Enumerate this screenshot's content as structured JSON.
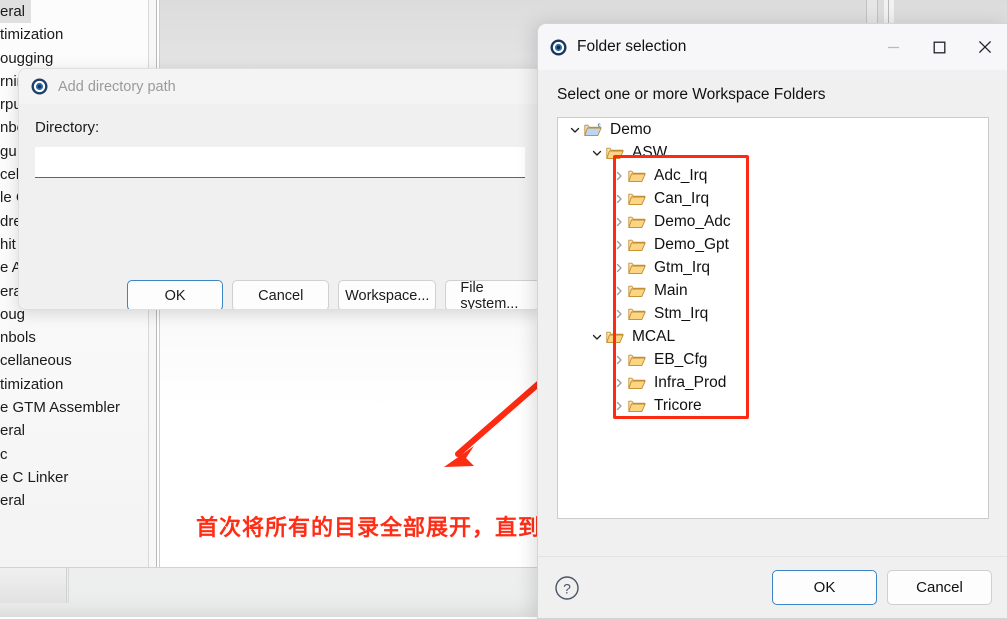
{
  "background": {
    "tree_items": [
      {
        "label": "eral",
        "selected": true
      },
      {
        "label": "timization",
        "selected": false
      },
      {
        "label": "ougging",
        "selected": false
      },
      {
        "label": "rnin",
        "selected": false
      },
      {
        "label": "rpu",
        "selected": false
      },
      {
        "label": "nbo",
        "selected": false
      },
      {
        "label": "gu",
        "selected": false
      },
      {
        "label": "cel",
        "selected": false
      },
      {
        "label": "le C",
        "selected": false
      },
      {
        "label": "dre",
        "selected": false
      },
      {
        "label": "hit",
        "selected": false
      },
      {
        "label": "e A",
        "selected": false
      },
      {
        "label": "eral",
        "selected": false
      },
      {
        "label": "oug",
        "selected": false
      },
      {
        "label": "nbols",
        "selected": false
      },
      {
        "label": "cellaneous",
        "selected": false
      },
      {
        "label": "timization",
        "selected": false
      },
      {
        "label": "e GTM Assembler",
        "selected": false
      },
      {
        "label": "eral",
        "selected": false
      },
      {
        "label": "c",
        "selected": false
      },
      {
        "label": "e C Linker",
        "selected": false
      },
      {
        "label": "eral",
        "selected": false
      }
    ]
  },
  "annotation": {
    "text": "首次将所有的目录全部展开，直到不可展开为止",
    "color": "#ff2d16",
    "arrow_color": "#fc2b11"
  },
  "add_directory_dialog": {
    "title": "Add directory path",
    "title_icon": "eclipse-icon",
    "field_label": "Directory:",
    "directory_value": "",
    "directory_placeholder": "",
    "buttons": [
      {
        "label": "OK",
        "default": true
      },
      {
        "label": "Cancel",
        "default": false
      },
      {
        "label": "Workspace...",
        "default": false
      },
      {
        "label": "File system...",
        "default": false
      }
    ]
  },
  "folder_selection_dialog": {
    "title": "Folder selection",
    "title_icon": "eclipse-icon",
    "window_buttons": [
      {
        "name": "minimize-button",
        "glyph": "minimize-icon",
        "enabled": false
      },
      {
        "name": "maximize-button",
        "glyph": "maximize-icon",
        "enabled": true
      },
      {
        "name": "close-button",
        "glyph": "close-icon",
        "enabled": true
      }
    ],
    "prompt": "Select one or more Workspace Folders",
    "tree": [
      {
        "label": "Demo",
        "depth": 0,
        "expanded": true,
        "icon": "project-folder-icon",
        "twisty": "chevron-down-icon"
      },
      {
        "label": "ASW",
        "depth": 1,
        "expanded": true,
        "icon": "folder-icon",
        "twisty": "chevron-down-icon"
      },
      {
        "label": "Adc_Irq",
        "depth": 2,
        "expanded": false,
        "icon": "folder-icon",
        "twisty": "chevron-right-icon"
      },
      {
        "label": "Can_Irq",
        "depth": 2,
        "expanded": false,
        "icon": "folder-icon",
        "twisty": "chevron-right-icon"
      },
      {
        "label": "Demo_Adc",
        "depth": 2,
        "expanded": false,
        "icon": "folder-icon",
        "twisty": "chevron-right-icon"
      },
      {
        "label": "Demo_Gpt",
        "depth": 2,
        "expanded": false,
        "icon": "folder-icon",
        "twisty": "chevron-right-icon"
      },
      {
        "label": "Gtm_Irq",
        "depth": 2,
        "expanded": false,
        "icon": "folder-icon",
        "twisty": "chevron-right-icon"
      },
      {
        "label": "Main",
        "depth": 2,
        "expanded": false,
        "icon": "folder-icon",
        "twisty": "chevron-right-icon"
      },
      {
        "label": "Stm_Irq",
        "depth": 2,
        "expanded": false,
        "icon": "folder-icon",
        "twisty": "chevron-right-icon"
      },
      {
        "label": "MCAL",
        "depth": 1,
        "expanded": true,
        "icon": "folder-icon",
        "twisty": "chevron-down-icon"
      },
      {
        "label": "EB_Cfg",
        "depth": 2,
        "expanded": false,
        "icon": "folder-icon",
        "twisty": "chevron-right-icon"
      },
      {
        "label": "Infra_Prod",
        "depth": 2,
        "expanded": false,
        "icon": "folder-icon",
        "twisty": "chevron-right-icon"
      },
      {
        "label": "Tricore",
        "depth": 2,
        "expanded": false,
        "icon": "folder-icon",
        "twisty": "chevron-right-icon"
      }
    ],
    "footer": {
      "help_icon": "help-icon",
      "ok_label": "OK",
      "cancel_label": "Cancel"
    }
  }
}
